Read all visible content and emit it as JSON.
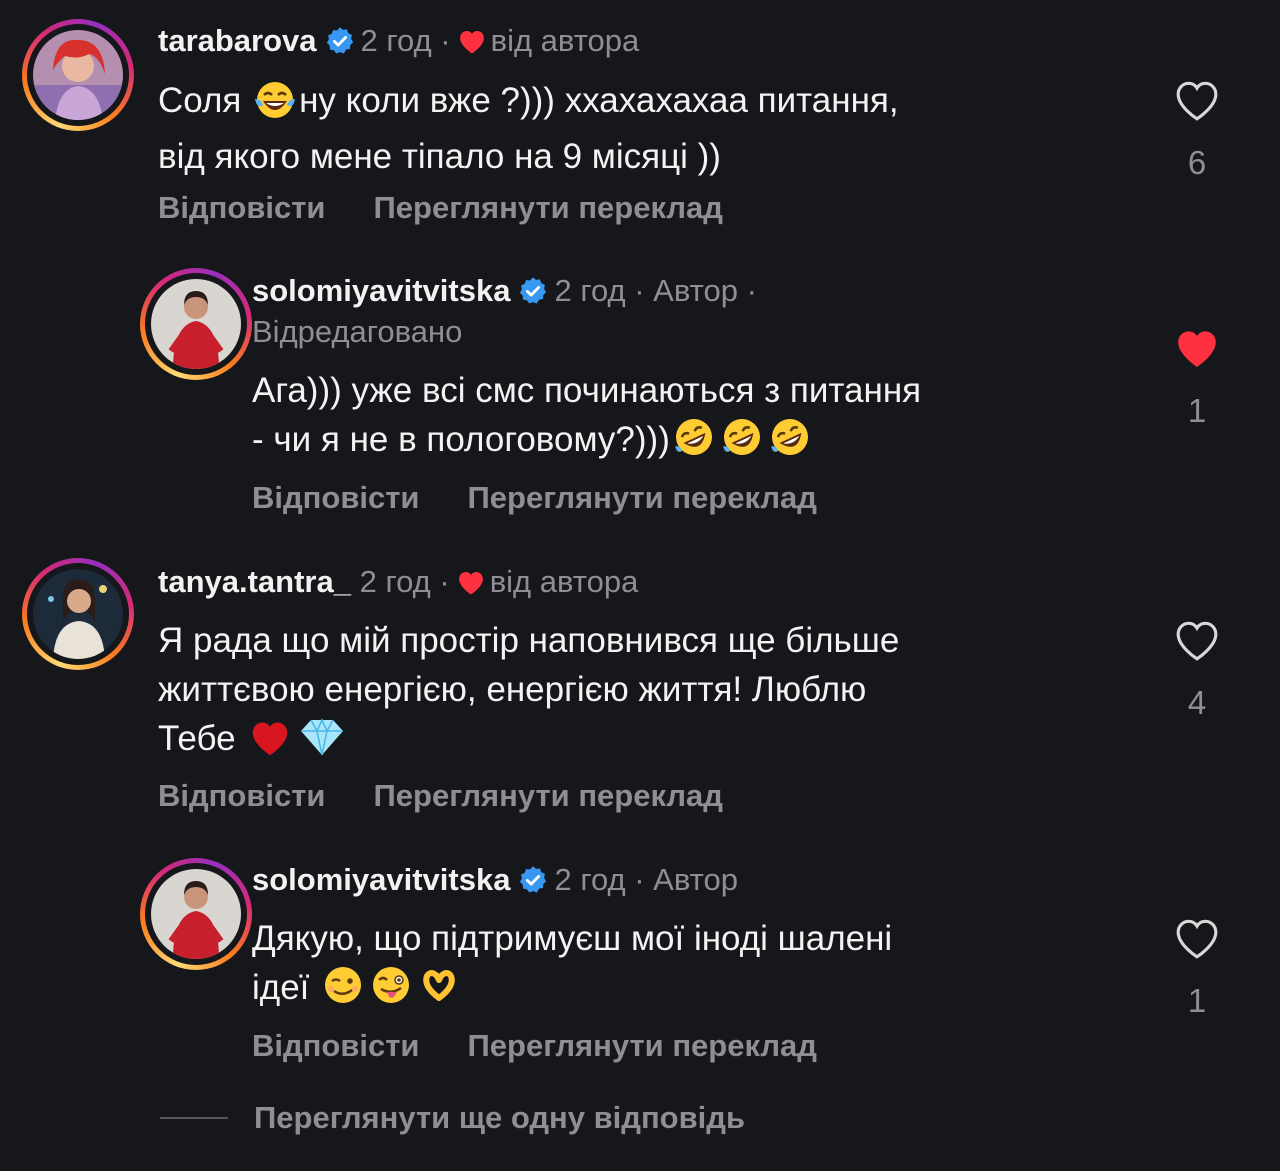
{
  "comments": [
    {
      "username": "tarabarova",
      "time": "2 год",
      "meta_separator": "·",
      "author_tag": "від автора",
      "text_line1_a": "Соля ",
      "text_line1_b": "ну коли вже ?))) ххахахахаа питання,",
      "text_line2": "від якого мене тіпало на 9 місяці ))",
      "like_count": "6",
      "liked": false,
      "reply_label": "Відповісти",
      "translate_label": "Переглянути переклад",
      "icons": [
        "verified-badge-icon",
        "heart-icon",
        "laughing-emoji"
      ]
    },
    {
      "username": "solomiyavitvitska",
      "time": "2 год",
      "role": "· Автор ·",
      "edited": "Відредаговано",
      "text_line1": "Ага))) уже всі смс починаються з питання",
      "text_line2": "- чи я не в пологовому?)))",
      "like_count": "1",
      "liked": true,
      "reply_label": "Відповісти",
      "translate_label": "Переглянути переклад",
      "icons": [
        "verified-badge-icon",
        "rofl-emoji",
        "rofl-emoji",
        "rofl-emoji"
      ]
    },
    {
      "username": "tanya.tantra_",
      "time": "2 год",
      "meta_separator": "·",
      "author_tag": "від автора",
      "text_line1": "Я рада що мій простір наповнився ще більше",
      "text_line2": "життєвою енергією, енергією життя! Люблю",
      "text_line3": "Тебе",
      "like_count": "4",
      "liked": false,
      "reply_label": "Відповісти",
      "translate_label": "Переглянути переклад",
      "icons": [
        "red-heart-emoji",
        "gem-emoji"
      ]
    },
    {
      "username": "solomiyavitvitska",
      "time": "2 год",
      "role": "· Автор",
      "text_line1": "Дякую, що підтримуєш мої іноді шалені",
      "text_line2": "ідеї",
      "like_count": "1",
      "liked": false,
      "reply_label": "Відповісти",
      "translate_label": "Переглянути переклад",
      "icons": [
        "verified-badge-icon",
        "wink-emoji",
        "zany-emoji",
        "heart-hands-emoji"
      ]
    }
  ],
  "more_replies_label": "Переглянути ще одну відповідь",
  "colors": {
    "background": "#16171b",
    "text": "#f3f3f3",
    "muted": "#8e8f95",
    "verified": "#3897f0",
    "heart": "#ff3040"
  }
}
